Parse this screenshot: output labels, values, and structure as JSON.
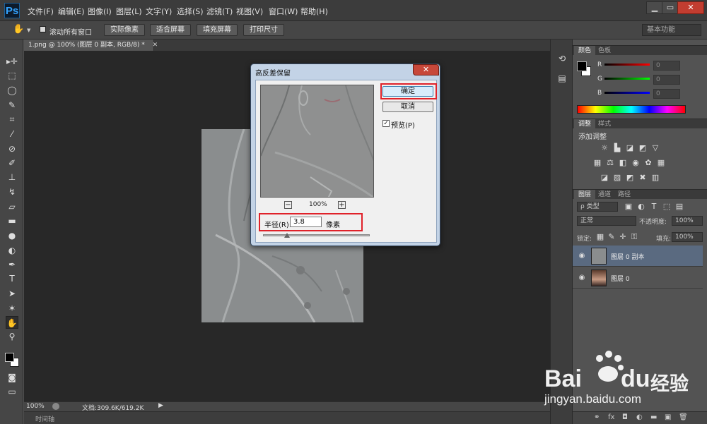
{
  "app": {
    "logo": "Ps",
    "menus": [
      "文件(F)",
      "编辑(E)",
      "图像(I)",
      "图层(L)",
      "文字(Y)",
      "选择(S)",
      "滤镜(T)",
      "视图(V)",
      "窗口(W)",
      "帮助(H)"
    ],
    "window_buttons": [
      "▁",
      "▭",
      "✕"
    ]
  },
  "options": {
    "scroll_all_windows": "滚动所有窗口",
    "actual_pixels": "实际像素",
    "fit_screen": "适合屏幕",
    "fill_screen": "填充屏幕",
    "print_size": "打印尺寸",
    "workspace": "基本功能"
  },
  "document": {
    "tab_title": "1.png @ 100% (图层 0 副本, RGB/8) *",
    "zoom": "100%",
    "doc_info": "文档:309.6K/619.2K",
    "timeline_label": "时间轴"
  },
  "dialog": {
    "title": "高反差保留",
    "close": "✕",
    "ok": "确定",
    "cancel": "取消",
    "preview_label": "预览(P)",
    "preview_checked": "✓",
    "zoom_minus": "−",
    "zoom_plus": "+",
    "zoom_level": "100%",
    "radius_label": "半径(R):",
    "radius_value": "3.8",
    "radius_unit": "像素",
    "highlight_color": "#e0222a"
  },
  "panels": {
    "color_tabs": [
      "颜色",
      "色板"
    ],
    "channels": [
      {
        "label": "R",
        "value": "0"
      },
      {
        "label": "G",
        "value": "0"
      },
      {
        "label": "B",
        "value": "0"
      }
    ],
    "adjust_tabs": [
      "调整",
      "样式"
    ],
    "add_adjustment": "添加调整",
    "layers_tabs": [
      "图层",
      "通道",
      "路径"
    ],
    "filter_kind": "ρ 类型",
    "blend_mode": "正常",
    "opacity_label": "不透明度:",
    "opacity_value": "100%",
    "lock_label": "锁定:",
    "fill_label": "填充:",
    "fill_value": "100%",
    "layers": [
      {
        "name": "图层 0 副本",
        "selected": true
      },
      {
        "name": "图层 0",
        "selected": false
      }
    ]
  },
  "watermark": {
    "brand": "Bai",
    "brand_tail": "du",
    "cn": "经验",
    "url": "jingyan.baidu.com"
  }
}
